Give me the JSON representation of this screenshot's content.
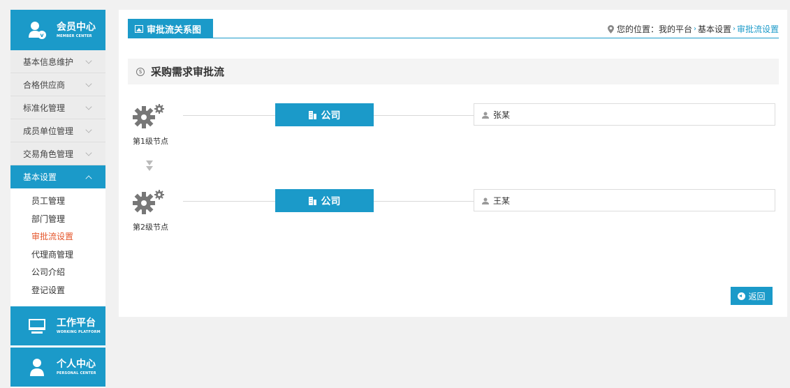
{
  "sidebar": {
    "member_center": {
      "title": "会员中心",
      "subtitle": "MEMBER CENTER",
      "icon": "member-icon"
    },
    "menu": [
      {
        "label": "基本信息维护",
        "expanded": false
      },
      {
        "label": "合格供应商",
        "expanded": false
      },
      {
        "label": "标准化管理",
        "expanded": false
      },
      {
        "label": "成员单位管理",
        "expanded": false
      },
      {
        "label": "交易角色管理",
        "expanded": false
      },
      {
        "label": "基本设置",
        "expanded": true
      }
    ],
    "submenu": [
      "员工管理",
      "部门管理",
      "审批流设置",
      "代理商管理",
      "公司介绍",
      "登记设置"
    ],
    "submenu_current": "审批流设置",
    "work_platform": {
      "title": "工作平台",
      "subtitle": "WORKING PLATFORM",
      "icon": "monitor-icon"
    },
    "personal_center": {
      "title": "个人中心",
      "subtitle": "PERSONAL CENTER",
      "icon": "person-icon"
    }
  },
  "header": {
    "tab_title": "审批流关系图",
    "breadcrumb": {
      "prefix": "您的位置：我的平台",
      "level2": "基本设置",
      "current": "审批流设置"
    }
  },
  "section": {
    "title": "采购需求审批流",
    "icon": "coin-icon"
  },
  "nodes": [
    {
      "label": "第1级节点",
      "company": "公司",
      "person": "张某"
    },
    {
      "label": "第2级节点",
      "company": "公司",
      "person": "王某"
    }
  ],
  "buttons": {
    "back": "返回"
  },
  "colors": {
    "accent": "#1b9ac9",
    "current_link": "#e4552a"
  }
}
